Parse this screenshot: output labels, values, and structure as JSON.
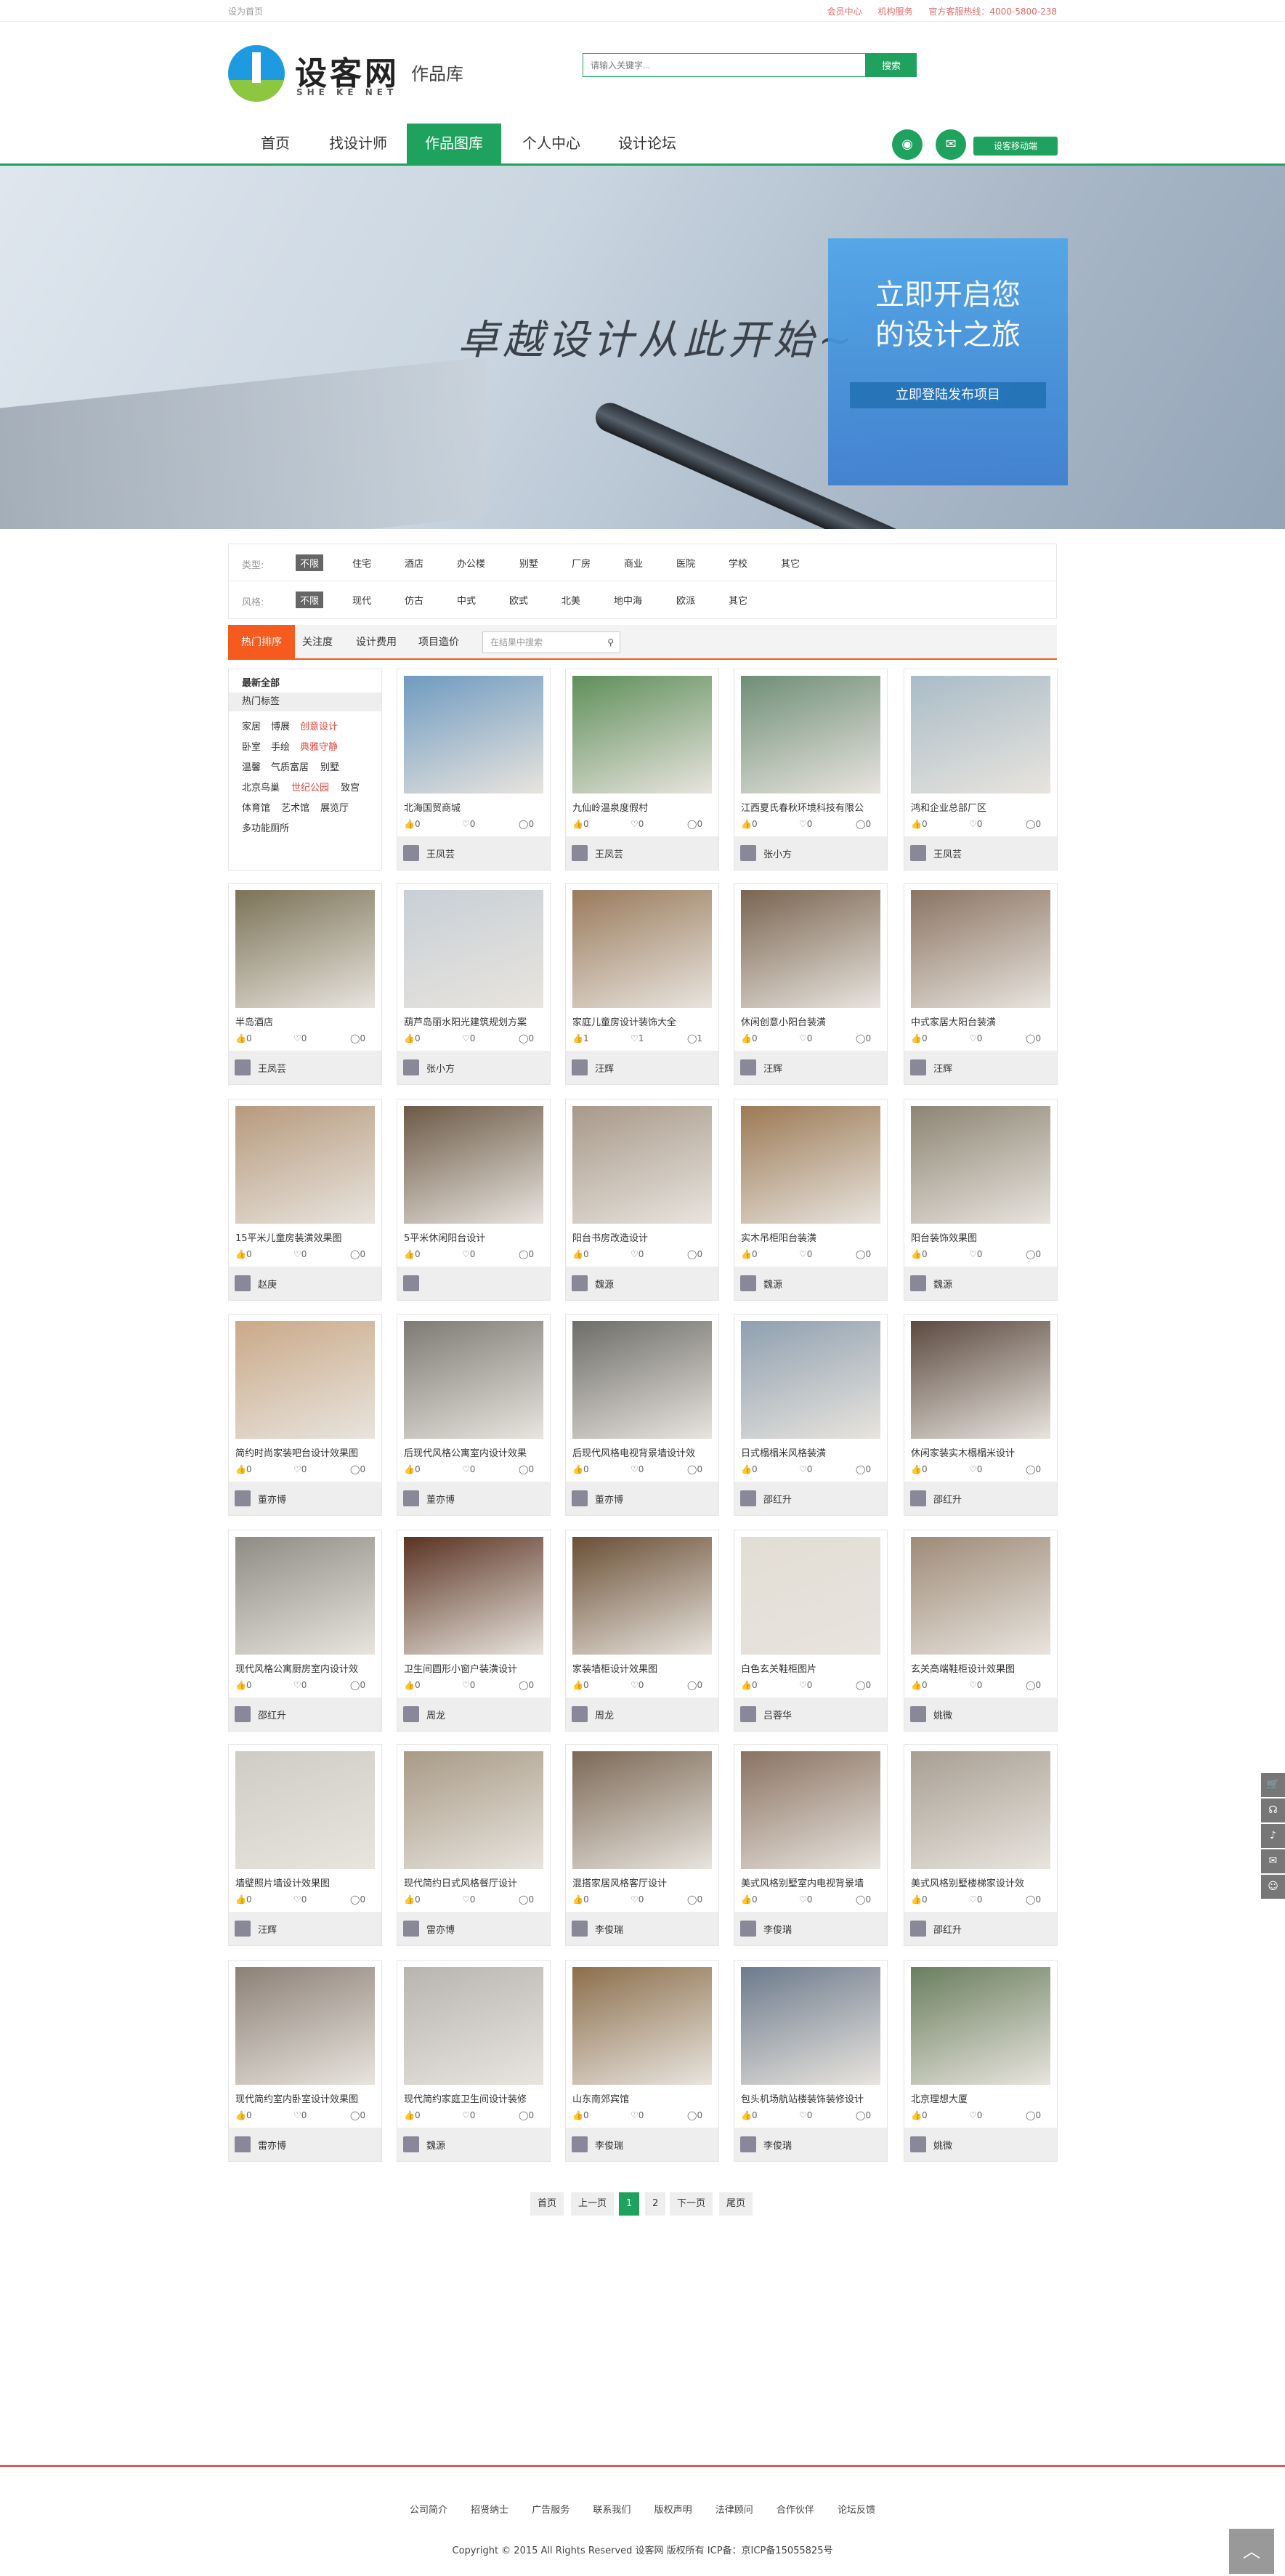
{
  "topbar": {
    "left": "设为首页",
    "right": [
      "会员中心",
      "机构服务",
      "官方客服热线：4000-5800-238"
    ]
  },
  "logo": {
    "name": "设客网",
    "en": "SHE KE NET"
  },
  "section": "作品库",
  "search": {
    "placeholder": "请输入关键字...",
    "button": "搜索"
  },
  "nav": {
    "items": [
      "首页",
      "找设计师",
      "作品图库",
      "个人中心",
      "设计论坛"
    ],
    "active": 2,
    "mobile": "设客移动端"
  },
  "banner": {
    "slogan": "卓越设计从此开始~",
    "cta_line1": "立即开启您",
    "cta_line2": "的设计之旅",
    "cta_button": "立即登陆发布项目"
  },
  "filter": {
    "type_label": "类型:",
    "types": [
      "不限",
      "住宅",
      "酒店",
      "办公楼",
      "别墅",
      "厂房",
      "商业",
      "医院",
      "学校",
      "其它"
    ],
    "style_label": "风格:",
    "styles": [
      "不限",
      "现代",
      "仿古",
      "中式",
      "欧式",
      "北美",
      "地中海",
      "欧派",
      "其它"
    ]
  },
  "tabs": {
    "items": [
      "热门排序",
      "关注度",
      "设计费用",
      "项目造价"
    ],
    "search_placeholder": "在结果中搜索"
  },
  "sidebar": {
    "title": "最新全部",
    "hot": "热门标签",
    "tags": [
      [
        "家居",
        "博展",
        "创意设计"
      ],
      [
        "卧室",
        "手绘",
        "典雅守静"
      ],
      [
        "温馨",
        "气质富居",
        "别墅"
      ],
      [
        "北京鸟巢",
        "世纪公园",
        "致宫"
      ],
      [
        "体育馆",
        "艺术馆",
        "展览厅"
      ],
      [
        "多功能厕所"
      ]
    ]
  },
  "cards": [
    {
      "title": "北海国贸商城",
      "likes": "0",
      "hearts": "0",
      "comments": "0",
      "author": "王凤芸",
      "color": "#6f9bc0"
    },
    {
      "title": "九仙岭温泉度假村",
      "likes": "0",
      "hearts": "0",
      "comments": "0",
      "author": "王凤芸",
      "color": "#5f8f5a"
    },
    {
      "title": "江西夏氏春秋环境科技有限公",
      "likes": "0",
      "hearts": "0",
      "comments": "0",
      "author": "张小方",
      "color": "#6f8e77"
    },
    {
      "title": "鸿和企业总部厂区",
      "likes": "0",
      "hearts": "0",
      "comments": "0",
      "author": "王凤芸",
      "color": "#a9bcc7"
    },
    {
      "title": "半岛酒店",
      "likes": "0",
      "hearts": "0",
      "comments": "0",
      "author": "王凤芸",
      "color": "#7b7256"
    },
    {
      "title": "葫芦岛丽水阳光建筑规划方案",
      "likes": "0",
      "hearts": "0",
      "comments": "0",
      "author": "张小方",
      "color": "#c8cfd6"
    },
    {
      "title": "家庭儿童房设计装饰大全",
      "likes": "1",
      "hearts": "1",
      "comments": "1",
      "author": "汪辉",
      "color": "#9a7b5c"
    },
    {
      "title": "休闲创意小阳台装潢",
      "likes": "0",
      "hearts": "0",
      "comments": "0",
      "author": "汪辉",
      "color": "#7a6551"
    },
    {
      "title": "中式家居大阳台装潢",
      "likes": "0",
      "hearts": "0",
      "comments": "0",
      "author": "汪辉",
      "color": "#8b7463"
    },
    {
      "title": "15平米儿童房装潢效果图",
      "likes": "0",
      "hearts": "0",
      "comments": "0",
      "author": "赵庚",
      "color": "#b79a7d"
    },
    {
      "title": "5平米休闲阳台设计",
      "likes": "0",
      "hearts": "0",
      "comments": "0",
      "author": "",
      "color": "#6c5a47"
    },
    {
      "title": "阳台书房改造设计",
      "likes": "0",
      "hearts": "0",
      "comments": "0",
      "author": "魏源",
      "color": "#a8998a"
    },
    {
      "title": "实木吊柜阳台装潢",
      "likes": "0",
      "hearts": "0",
      "comments": "0",
      "author": "魏源",
      "color": "#9c7a55"
    },
    {
      "title": "阳台装饰效果图",
      "likes": "0",
      "hearts": "0",
      "comments": "0",
      "author": "魏源",
      "color": "#8d8574"
    },
    {
      "title": "简约时尚家装吧台设计效果图",
      "likes": "0",
      "hearts": "0",
      "comments": "0",
      "author": "董亦博",
      "color": "#caa988"
    },
    {
      "title": "后现代风格公寓室内设计效果",
      "likes": "0",
      "hearts": "0",
      "comments": "0",
      "author": "董亦博",
      "color": "#7e7a74"
    },
    {
      "title": "后现代风格电视背景墙设计效",
      "likes": "0",
      "hearts": "0",
      "comments": "0",
      "author": "董亦博",
      "color": "#6e6d69"
    },
    {
      "title": "日式榻榻米风格装潢",
      "likes": "0",
      "hearts": "0",
      "comments": "0",
      "author": "邵红升",
      "color": "#8fa0b0"
    },
    {
      "title": "休闲家装实木榻榻米设计",
      "likes": "0",
      "hearts": "0",
      "comments": "0",
      "author": "邵红升",
      "color": "#5c4a40"
    },
    {
      "title": "现代风格公寓厨房室内设计效",
      "likes": "0",
      "hearts": "0",
      "comments": "0",
      "author": "邵红升",
      "color": "#8f8c86"
    },
    {
      "title": "卫生间圆形小窗户装潢设计",
      "likes": "0",
      "hearts": "0",
      "comments": "0",
      "author": "周龙",
      "color": "#5a3322"
    },
    {
      "title": "家装墙柜设计效果图",
      "likes": "0",
      "hearts": "0",
      "comments": "0",
      "author": "周龙",
      "color": "#6a4f35"
    },
    {
      "title": "白色玄关鞋柜图片",
      "likes": "0",
      "hearts": "0",
      "comments": "0",
      "author": "吕蓉华",
      "color": "#e2ddd4"
    },
    {
      "title": "玄关高端鞋柜设计效果图",
      "likes": "0",
      "hearts": "0",
      "comments": "0",
      "author": "姚微",
      "color": "#9e8b78"
    },
    {
      "title": "墙壁照片墙设计效果图",
      "likes": "0",
      "hearts": "0",
      "comments": "0",
      "author": "汪辉",
      "color": "#cfcbc5"
    },
    {
      "title": "现代简约日式风格餐厅设计",
      "likes": "0",
      "hearts": "0",
      "comments": "0",
      "author": "雷亦博",
      "color": "#a89a86"
    },
    {
      "title": "混搭家居风格客厅设计",
      "likes": "0",
      "hearts": "0",
      "comments": "0",
      "author": "李俊瑞",
      "color": "#7c6956"
    },
    {
      "title": "美式风格别墅室内电视背景墙",
      "likes": "0",
      "hearts": "0",
      "comments": "0",
      "author": "李俊瑞",
      "color": "#8a7262"
    },
    {
      "title": "美式风格别墅楼梯家设计效",
      "likes": "0",
      "hearts": "0",
      "comments": "0",
      "author": "邵红升",
      "color": "#a89f93"
    },
    {
      "title": "现代简约室内卧室设计效果图",
      "likes": "0",
      "hearts": "0",
      "comments": "0",
      "author": "雷亦博",
      "color": "#8d8177"
    },
    {
      "title": "现代简约家庭卫生间设计装修",
      "likes": "0",
      "hearts": "0",
      "comments": "0",
      "author": "魏源",
      "color": "#b8b5b1"
    },
    {
      "title": "山东南郊宾馆",
      "likes": "0",
      "hearts": "0",
      "comments": "0",
      "author": "李俊瑞",
      "color": "#8c6f4c"
    },
    {
      "title": "包头机场航站楼装饰装修设计",
      "likes": "0",
      "hearts": "0",
      "comments": "0",
      "author": "李俊瑞",
      "color": "#6d7b8d"
    },
    {
      "title": "北京理想大厦",
      "likes": "0",
      "hearts": "0",
      "comments": "0",
      "author": "姚微",
      "color": "#6a7f5e"
    }
  ],
  "pager": {
    "first": "首页",
    "prev": "上一页",
    "pages": [
      "1",
      "2"
    ],
    "next": "下一页",
    "last": "尾页"
  },
  "footer": {
    "links": [
      "公司简介",
      "招贤纳士",
      "广告服务",
      "联系我们",
      "版权声明",
      "法律顾问",
      "合作伙伴",
      "论坛反馈"
    ],
    "copyright": "Copyright © 2015 All Rights Reserved 设客网 版权所有 ICP备：京ICP备15055825号"
  }
}
